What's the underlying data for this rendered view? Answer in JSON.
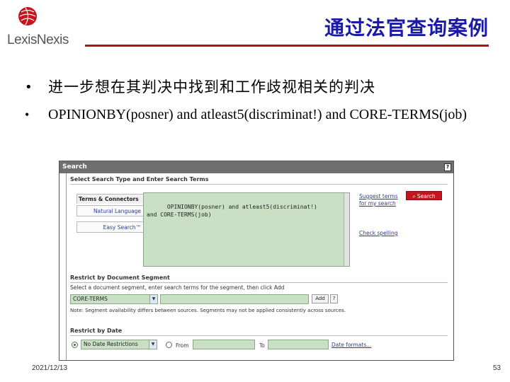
{
  "brand": {
    "name": "LexisNexis"
  },
  "slide": {
    "title": "通过法官查询案例",
    "bullets": [
      "进一步想在其判决中找到和工作歧视相关的判决",
      "OPINIONBY(posner) and atleast5(discriminat!) and CORE-TERMS(job)"
    ],
    "date": "2021/12/13",
    "page_number": "53"
  },
  "search_panel": {
    "title": "Search",
    "help_label": "?",
    "section_type": "Select Search Type and Enter Search Terms",
    "tab_active": "Terms & Connectors",
    "tabs": [
      "Natural Language",
      "Easy Search™"
    ],
    "terms_text": "OPINIONBY(posner) and atleast5(discriminat!)\nand CORE-TERMS(job)",
    "suggest_link_1": "Suggest terms",
    "suggest_link_2": "for my search",
    "search_button": "Search",
    "check_spelling": "Check spelling",
    "section_segment": "Restrict by Document Segment",
    "segment_instruction": "Select a document segment, enter search terms for the segment, then click Add",
    "segment_value": "CORE-TERMS",
    "add_button": "Add",
    "segment_note": "Note: Segment availability differs between sources. Segments may not be applied consistently across sources.",
    "section_date": "Restrict by Date",
    "date_option": "No Date Restrictions",
    "from_label": "From",
    "to_label": "To",
    "date_formats_link": "Date formats..."
  },
  "colors": {
    "title": "#1a1aa6",
    "rule": "#b0121b",
    "accent": "#c4161c",
    "field": "#c9e0c4"
  }
}
